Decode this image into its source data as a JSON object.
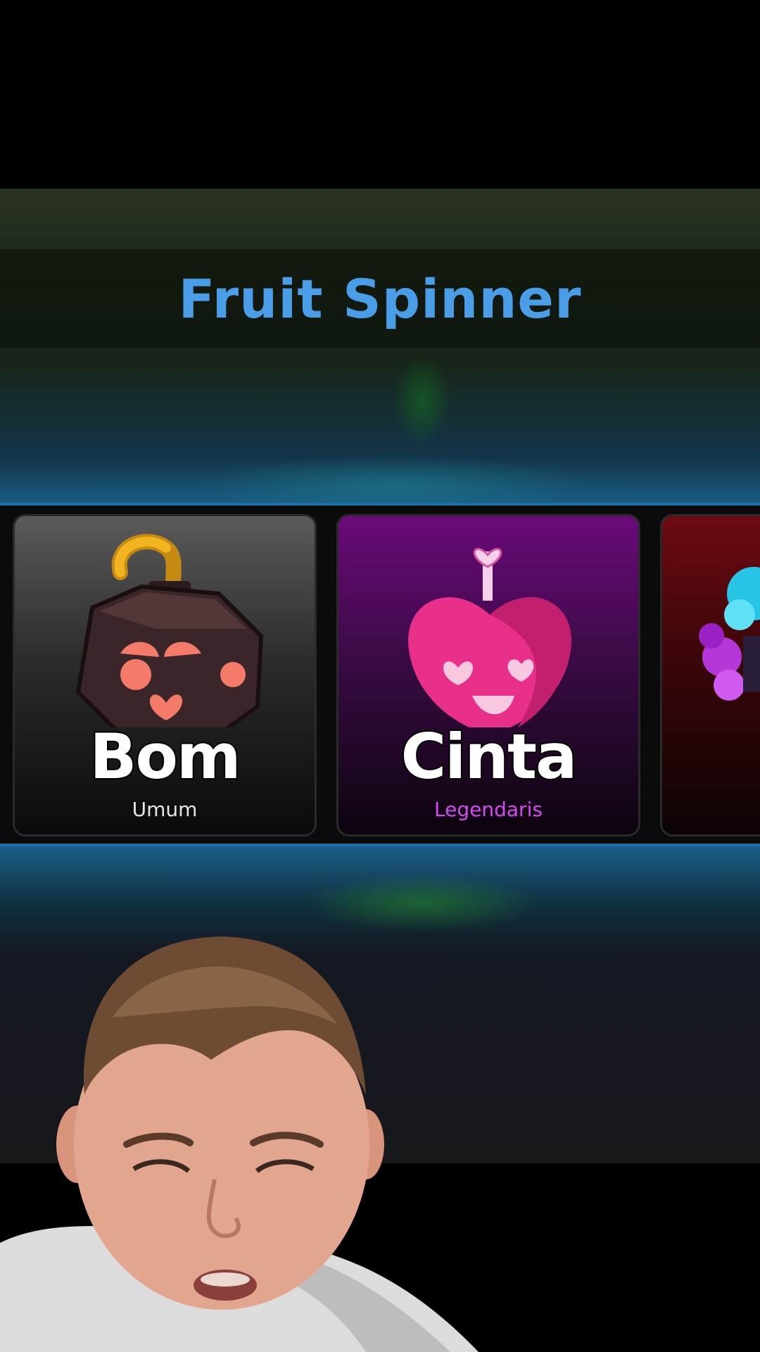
{
  "screen": {
    "title": "Fruit Spinner"
  },
  "colors": {
    "title": "#4a9ee8",
    "strip_border": "#1d6fa8",
    "rarity_common": "#e6e6e6",
    "rarity_legendary": "#d44cf0"
  },
  "cards": [
    {
      "name": "Bom",
      "rarity": "Umum",
      "icon": "bomb-fruit-icon",
      "theme": "gray"
    },
    {
      "name": "Cinta",
      "rarity": "Legendaris",
      "icon": "love-fruit-icon",
      "theme": "purple"
    },
    {
      "name": "",
      "rarity": "",
      "icon": "partial-fruit-icon",
      "theme": "red"
    }
  ]
}
